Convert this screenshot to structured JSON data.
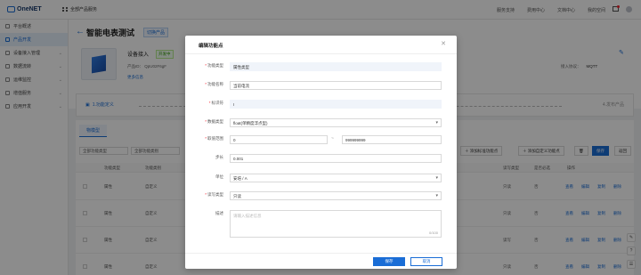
{
  "topbar": {
    "brand": "OneNET",
    "all_products": "全部产品服务",
    "links": [
      "服务支持",
      "费用中心",
      "文档中心",
      "我的空间"
    ]
  },
  "sidebar": {
    "items": [
      {
        "label": "平台概述"
      },
      {
        "label": "产品开发"
      },
      {
        "label": "设备接入管理"
      },
      {
        "label": "数据流转"
      },
      {
        "label": "运维监控"
      },
      {
        "label": "增值服务"
      },
      {
        "label": "应用开发"
      }
    ]
  },
  "header": {
    "title": "智能电表测试",
    "product_tag": "切换产品",
    "device_name": "设备接入",
    "status": "开发中",
    "product_id": "产品ID：  QpU02F6gF",
    "more_info": "更多信息",
    "protocol_label": "接入协议：",
    "protocol_value": "MQTT"
  },
  "steps": {
    "current": "1.功能定义",
    "last": "4.发布产品"
  },
  "content": {
    "tab": "物模型",
    "filter_type": "全部功能类型",
    "filter_data": "全部功能类别",
    "btn_add_std": "添加标准功能点",
    "btn_add_custom": "添加自定义功能点",
    "btn_save": "保存",
    "btn_back": "返回",
    "headers": [
      "功能类型",
      "功能类别",
      "读写类型",
      "是否必选",
      "操作"
    ],
    "rows": [
      {
        "type": "属性",
        "category": "自定义",
        "rw": "只读",
        "required": "否"
      },
      {
        "type": "属性",
        "category": "自定义",
        "rw": "只读",
        "required": "否"
      },
      {
        "type": "属性",
        "category": "自定义",
        "rw": "读写",
        "required": "否"
      },
      {
        "type": "属性",
        "category": "自定义",
        "rw": "只读",
        "required": "否"
      }
    ],
    "ops": [
      "查看",
      "编辑",
      "复制",
      "删除"
    ],
    "partial_cell": "float(单精度浮点"
  },
  "modal": {
    "title": "编辑功能点",
    "fields": {
      "func_type_label": "功能类型",
      "func_type_value": "属性类型",
      "func_name_label": "功能名称",
      "func_name_value": "当前电流",
      "identifier_label": "标识符",
      "identifier_value": "I",
      "data_type_label": "数据类型",
      "data_type_value": "float(单精度浮点型)",
      "range_label": "取值范围",
      "range_min": "0",
      "range_max": "999999999",
      "step_label": "步长",
      "step_value": "0.001",
      "unit_label": "单位",
      "unit_value": "安培 / A",
      "rw_label": "读写类型",
      "rw_value": "只读",
      "desc_label": "描述",
      "desc_placeholder": "请输入描述信息",
      "desc_counter": "0/100"
    },
    "ok": "保存",
    "cancel": "取消"
  }
}
